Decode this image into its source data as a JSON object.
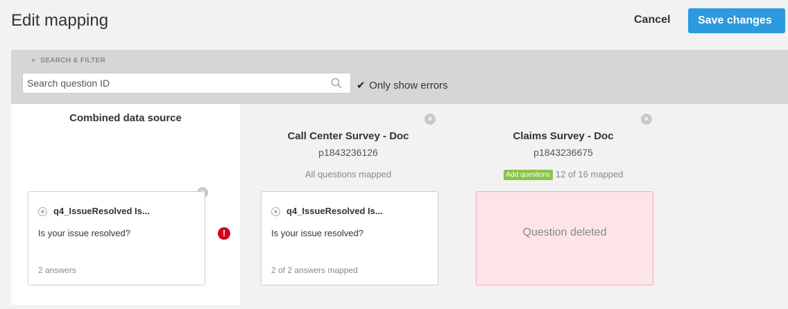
{
  "header": {
    "title": "Edit mapping",
    "cancel_label": "Cancel",
    "save_label": "Save changes"
  },
  "filter": {
    "section_label": "SEARCH & FILTER",
    "search_placeholder": "Search question ID",
    "only_errors_label": "Only show errors",
    "only_errors_checked": true
  },
  "columns": {
    "combined": {
      "title": "Combined data source",
      "card": {
        "question_id": "q4_IssueResolved Is...",
        "question_text": "Is your issue resolved?",
        "footer": "2 answers"
      },
      "error_glyph": "!"
    },
    "call_center": {
      "title": "Call Center Survey - Doc",
      "id": "p1843236126",
      "status": "All questions mapped",
      "card": {
        "question_id": "q4_IssueResolved Is...",
        "question_text": "Is your issue resolved?",
        "footer": "2 of 2 answers mapped"
      }
    },
    "claims": {
      "title": "Claims Survey - Doc",
      "id": "p1843236675",
      "add_questions_label": "Add questions",
      "status": "12 of 16 mapped",
      "deleted_label": "Question deleted"
    }
  },
  "colors": {
    "primary": "#2c9ae0",
    "error": "#d0021b",
    "success_badge": "#8bc34a",
    "deleted_bg": "#fce4e7"
  },
  "icons": {
    "search": "search-icon",
    "close": "close-icon",
    "error": "error-icon",
    "radio": "radio-icon",
    "checkmark": "checkmark-icon"
  }
}
